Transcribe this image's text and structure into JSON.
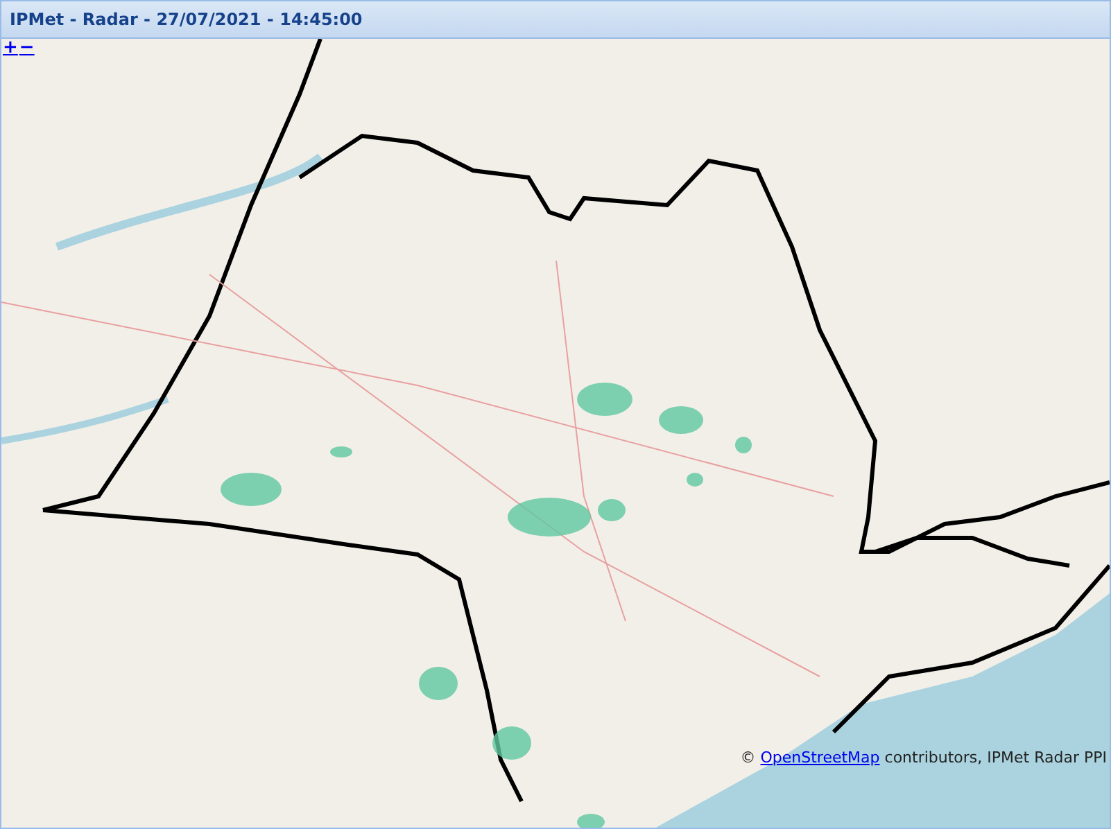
{
  "window": {
    "title": "IPMet - Radar - 27/07/2021 - 14:45:00"
  },
  "zoom_controls": [
    {
      "label": "+"
    },
    {
      "label": "−"
    }
  ],
  "attribution": {
    "prefix": "©",
    "link": "OpenStreetMap",
    "suffix": "contributors, IPMet Radar PPI"
  }
}
